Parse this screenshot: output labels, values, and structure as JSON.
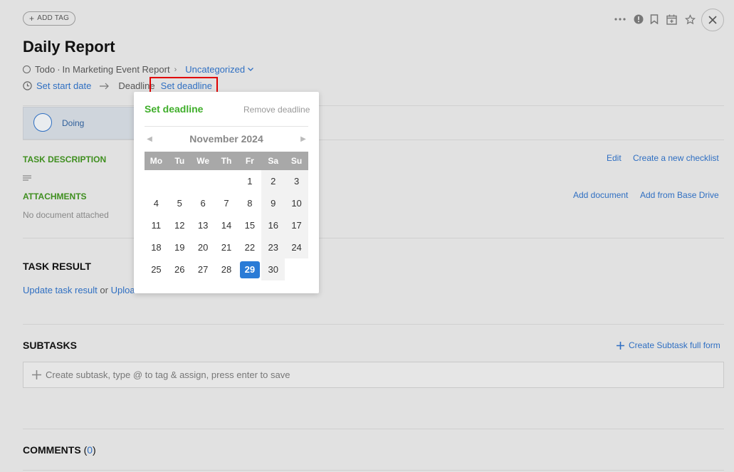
{
  "header": {
    "add_tag_label": "ADD TAG",
    "icons": [
      "more-icon",
      "priority-icon",
      "bookmark-icon",
      "calendar-add-icon",
      "star-icon",
      "close-icon"
    ]
  },
  "task": {
    "title": "Daily Report",
    "status": "Todo",
    "separator": "·",
    "in_label": "In Marketing Event Report",
    "category": "Uncategorized",
    "set_start_label": "Set start date",
    "deadline_label": "Deadline",
    "set_deadline_label": "Set deadline"
  },
  "stage": {
    "label": "Doing"
  },
  "description": {
    "heading": "TASK DESCRIPTION",
    "edit_label": "Edit",
    "checklist_label": "Create a new checklist"
  },
  "attachments": {
    "heading": "ATTACHMENTS",
    "empty_label": "No document attached",
    "add_doc_label": "Add document",
    "add_drive_label": "Add from Base Drive"
  },
  "result": {
    "heading": "TASK RESULT",
    "update_label": "Update task result",
    "or_label": "or",
    "upload_label": "Uploa"
  },
  "subtasks": {
    "heading": "SUBTASKS",
    "create_full_label": "Create Subtask full form",
    "input_placeholder": "Create subtask, type @ to tag & assign, press enter to save"
  },
  "comments": {
    "heading": "COMMENTS",
    "open": "(",
    "count": "0",
    "close": ")"
  },
  "deadline_popup": {
    "title": "Set deadline",
    "remove_label": "Remove deadline",
    "month_label": "November 2024",
    "weekdays": [
      "Mo",
      "Tu",
      "We",
      "Th",
      "Fr",
      "Sa",
      "Su"
    ],
    "days": [
      [
        "",
        "",
        "",
        "",
        "1",
        "2",
        "3"
      ],
      [
        "4",
        "5",
        "6",
        "7",
        "8",
        "9",
        "10"
      ],
      [
        "11",
        "12",
        "13",
        "14",
        "15",
        "16",
        "17"
      ],
      [
        "18",
        "19",
        "20",
        "21",
        "22",
        "23",
        "24"
      ],
      [
        "25",
        "26",
        "27",
        "28",
        "29",
        "30",
        ""
      ]
    ],
    "selected_day": "29"
  },
  "colors": {
    "accent": "#2f6fc2",
    "section_green": "#3f8f1f",
    "popup_title_green": "#3fae2a",
    "selected_day_bg": "#2a7bd6",
    "highlight_border": "#e00000"
  }
}
